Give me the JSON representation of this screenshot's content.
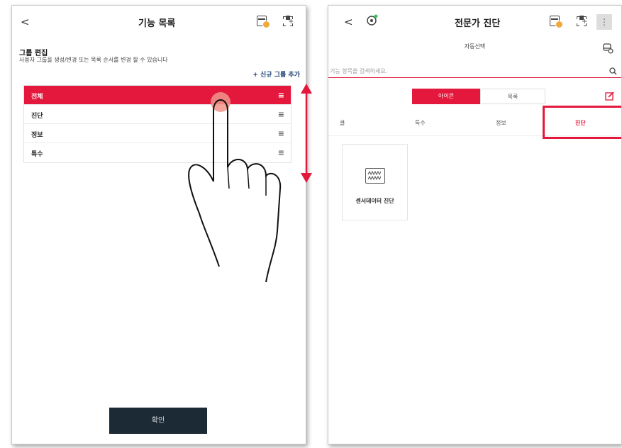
{
  "left": {
    "title": "기능 목록",
    "back_glyph": "<",
    "section_title": "그룹 편집",
    "section_desc": "사용자 그룹을 생성/변경 또는 목록 순서를 변경 할 수 있습니다",
    "add_group": "+ 신규 그룹 추가",
    "groups": [
      {
        "label": "전체",
        "active": true
      },
      {
        "label": "진단",
        "active": false
      },
      {
        "label": "정보",
        "active": false
      },
      {
        "label": "특수",
        "active": false
      }
    ],
    "handle_glyph": "≡",
    "confirm": "확인"
  },
  "right": {
    "title": "전문가 진단",
    "back_glyph": "<",
    "more_glyph": "⋮",
    "auto_select": "자동선택",
    "search_placeholder": "기능 항목을 검색하세요.",
    "view_toggle": [
      "아이콘",
      "목록"
    ],
    "tabs": [
      "특수",
      "정보",
      "진단"
    ],
    "tab_partial": "클",
    "active_tab": "진단",
    "tile_label": "센서데이터 진단"
  },
  "colors": {
    "accent": "#e3183c",
    "dark_button": "#1c2a36",
    "link": "#173d73"
  },
  "icons": [
    "vci-connection-icon",
    "fullscreen-icon",
    "search-icon",
    "edit-icon",
    "car-settings-icon",
    "sensor-data-icon",
    "pointing-hand-icon",
    "drag-arrow-icon",
    "diagnostic-status-icon"
  ]
}
